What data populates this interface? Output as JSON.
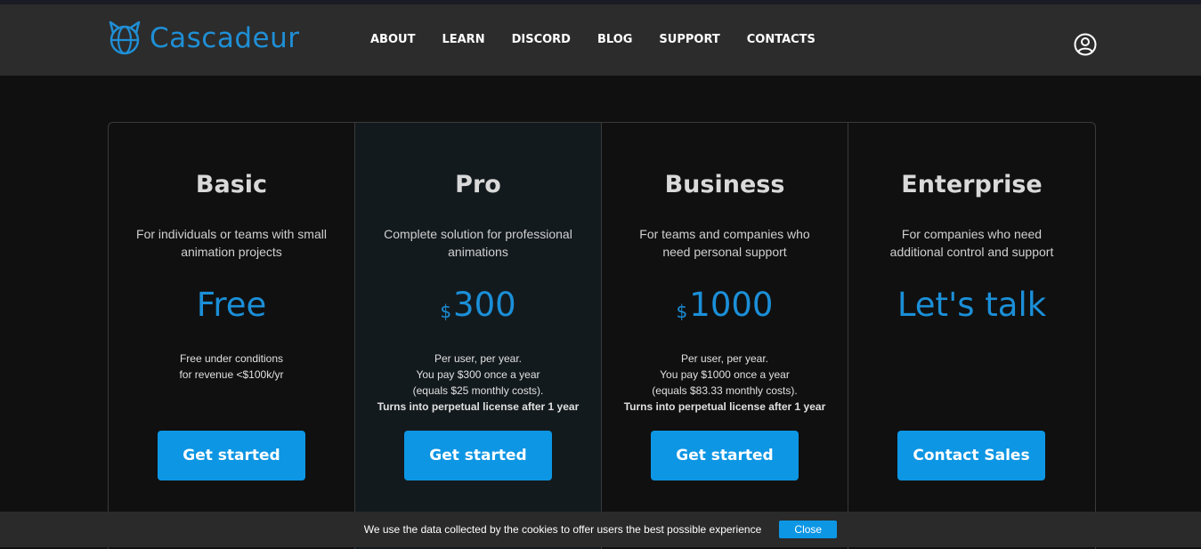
{
  "header": {
    "logo_text": "Cascadeur",
    "logo_icon": "cat-globe-icon",
    "nav": [
      {
        "label": "ABOUT"
      },
      {
        "label": "LEARN"
      },
      {
        "label": "DISCORD"
      },
      {
        "label": "BLOG"
      },
      {
        "label": "SUPPORT"
      },
      {
        "label": "CONTACTS"
      }
    ],
    "user_icon": "user-account-icon"
  },
  "plans": [
    {
      "title": "Basic",
      "desc_line1": "For individuals or teams with small",
      "desc_line2": "animation projects",
      "currency": "",
      "price": "Free",
      "notes": [
        "Free under conditions",
        "for revenue <$100k/yr"
      ],
      "notes_strong": "",
      "cta": "Get started"
    },
    {
      "title": "Pro",
      "desc_line1": "Complete solution for professional",
      "desc_line2": "animations",
      "currency": "$",
      "price": "300",
      "notes": [
        "Per user, per year.",
        "You pay $300 once a year",
        "(equals $25 monthly costs)."
      ],
      "notes_strong": "Turns into perpetual license after 1 year",
      "cta": "Get started"
    },
    {
      "title": "Business",
      "desc_line1": "For teams and companies who",
      "desc_line2": "need personal support",
      "currency": "$",
      "price": "1000",
      "notes": [
        "Per user, per year.",
        "You pay $1000 once a year",
        "(equals $83.33 monthly costs)."
      ],
      "notes_strong": "Turns into perpetual license after 1 year",
      "cta": "Get started"
    },
    {
      "title": "Enterprise",
      "desc_line1": "For companies who need",
      "desc_line2": "additional control and support",
      "currency": "",
      "price": "Let's talk",
      "notes": [],
      "notes_strong": "",
      "cta": "Contact Sales"
    }
  ],
  "cookie": {
    "text": "We use the data collected by the cookies to offer users the best possible experience",
    "close_label": "Close"
  },
  "colors": {
    "accent": "#0d96e4",
    "price": "#1b8fd8",
    "background": "#101010",
    "header": "#2c2c2c"
  }
}
